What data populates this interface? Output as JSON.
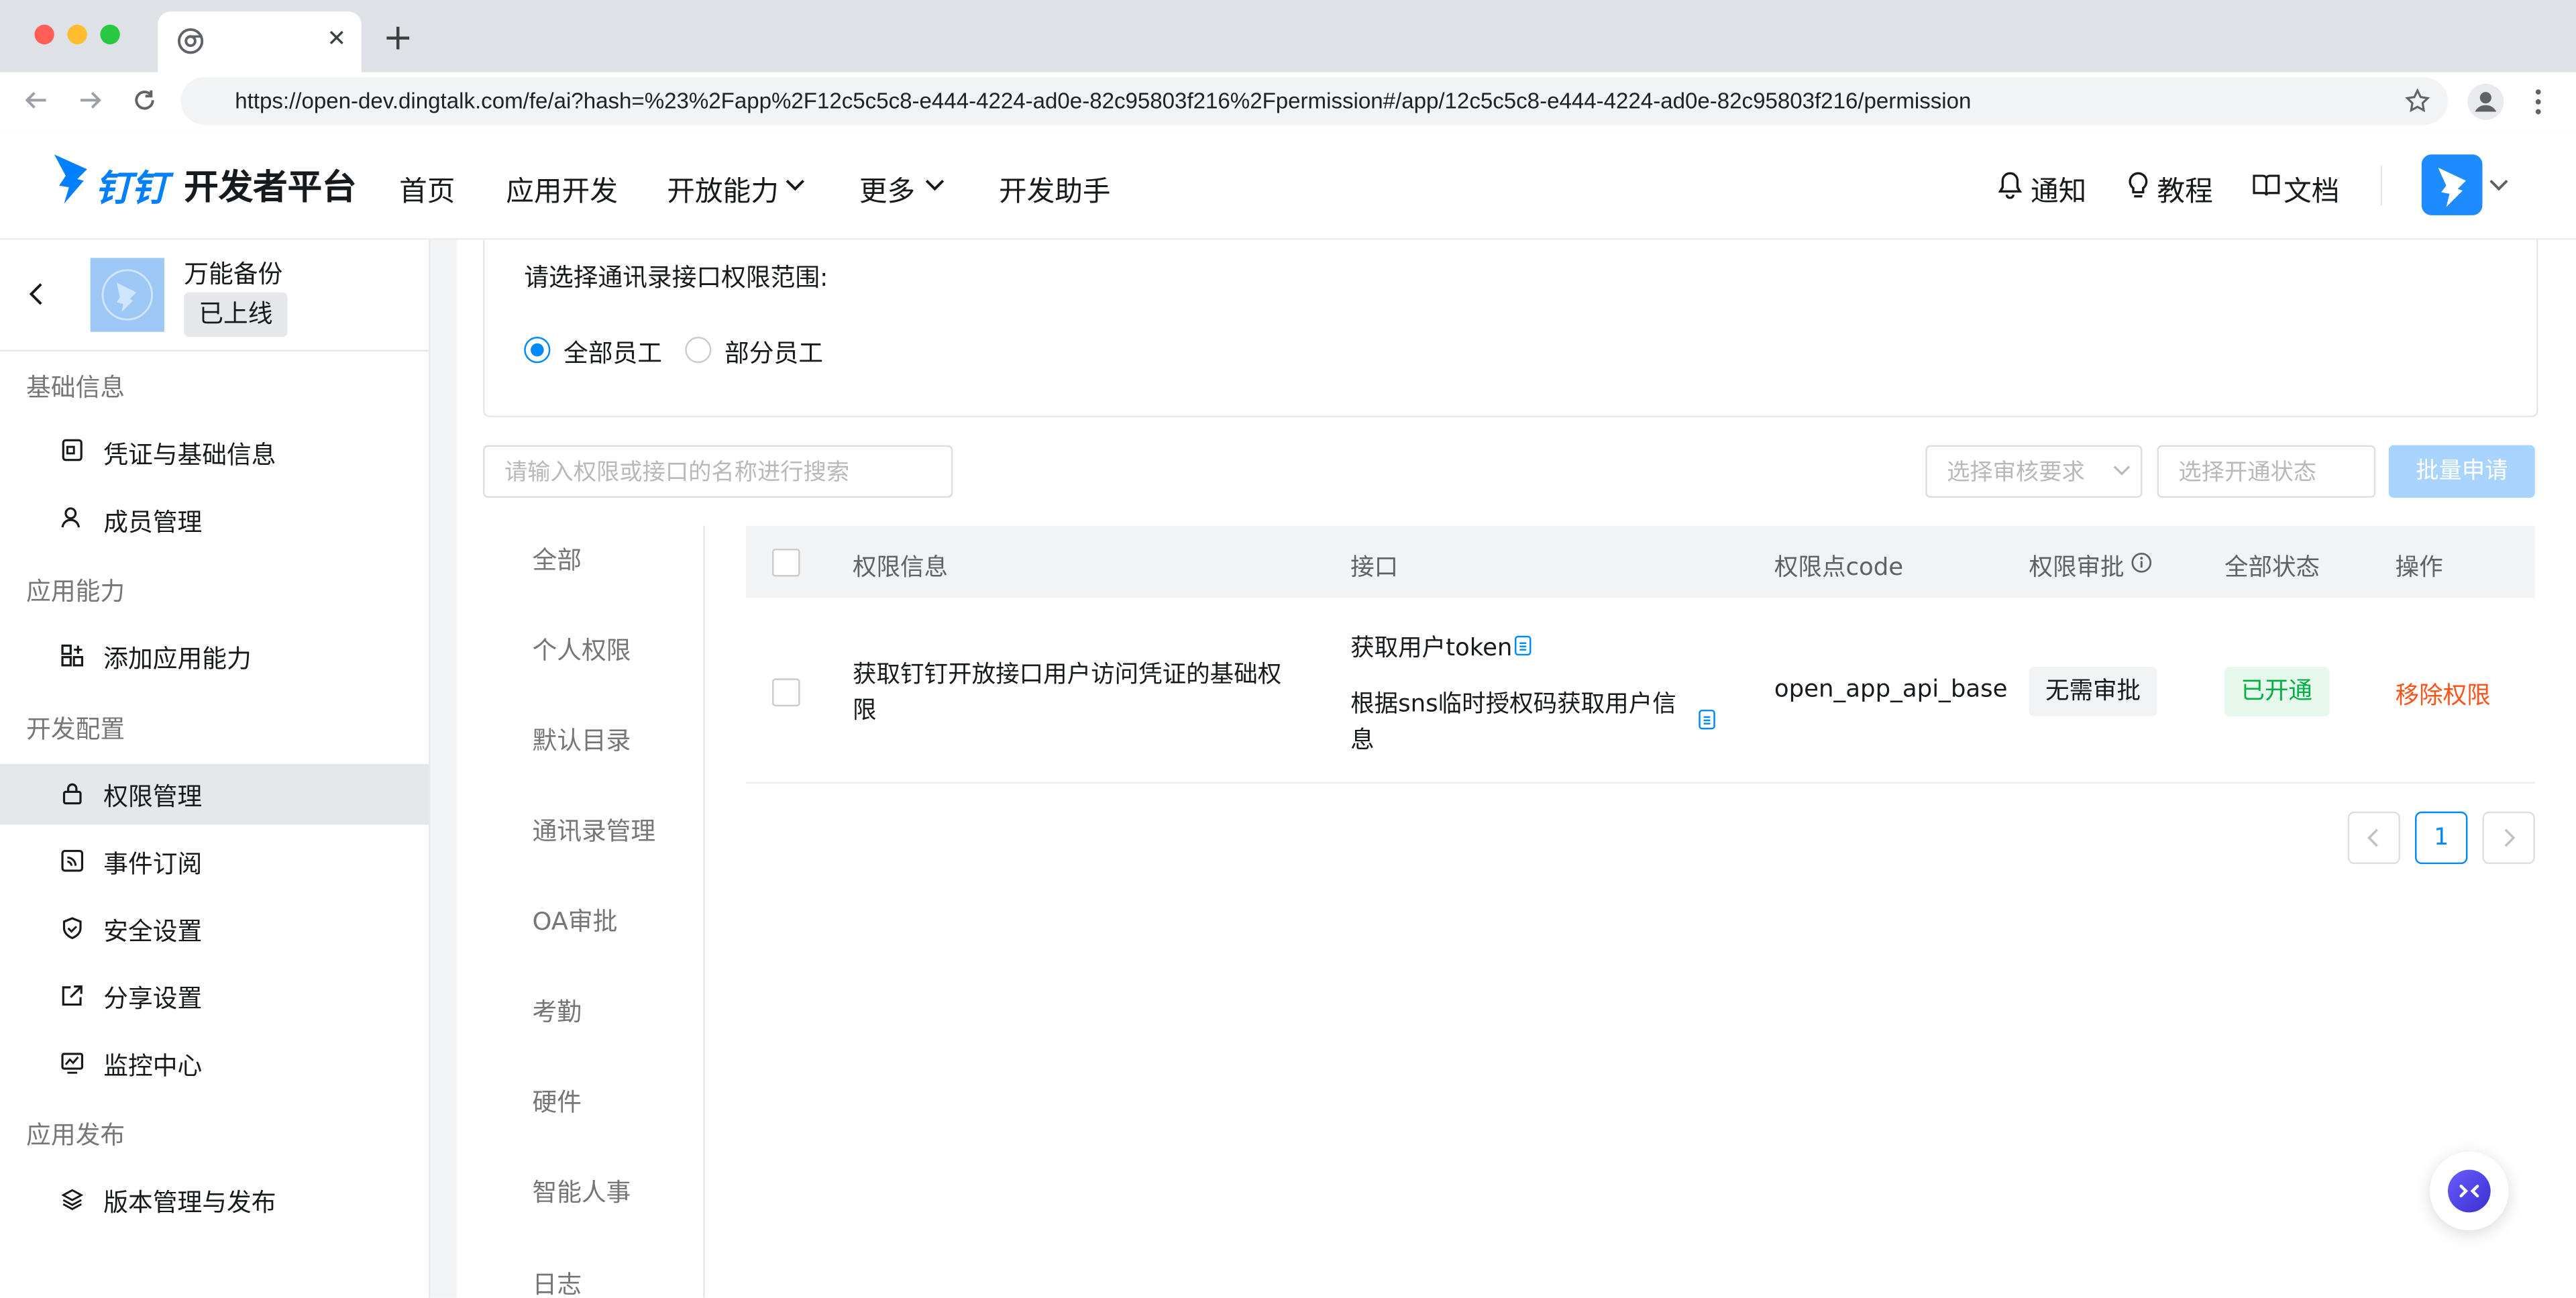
{
  "browser": {
    "url": "https://open-dev.dingtalk.com/fe/ai?hash=%23%2Fapp%2F12c5c5c8-e444-4224-ad0e-82c95803f216%2Fpermission#/app/12c5c5c8-e444-4224-ad0e-82c95803f216/permission",
    "new_tab": "+",
    "close_tab": "✕"
  },
  "header": {
    "logo_text": "钉钉",
    "platform_name": "开发者平台",
    "nav": [
      {
        "label": "首页"
      },
      {
        "label": "应用开发"
      },
      {
        "label": "开放能力"
      },
      {
        "label": "更多"
      },
      {
        "label": "开发助手"
      }
    ],
    "notify": "通知",
    "tutorial": "教程",
    "docs": "文档"
  },
  "app": {
    "name": "万能备份",
    "status": "已上线"
  },
  "sidebar": {
    "groups": [
      {
        "title": "基础信息",
        "items": [
          "凭证与基础信息",
          "成员管理"
        ]
      },
      {
        "title": "应用能力",
        "items": [
          "添加应用能力"
        ]
      },
      {
        "title": "开发配置",
        "items": [
          "权限管理",
          "事件订阅",
          "安全设置",
          "分享设置",
          "监控中心"
        ]
      },
      {
        "title": "应用发布",
        "items": [
          "版本管理与发布"
        ]
      }
    ],
    "active": "权限管理"
  },
  "scope": {
    "label": "请选择通讯录接口权限范围:",
    "options": [
      "全部员工",
      "部分员工"
    ],
    "selected": "全部员工"
  },
  "filters": {
    "search_placeholder": "请输入权限或接口的名称进行搜索",
    "audit_placeholder": "选择审核要求",
    "status_placeholder": "选择开通状态",
    "batch_button": "批量申请"
  },
  "categories": [
    "全部",
    "个人权限",
    "默认目录",
    "通讯录管理",
    "OA审批",
    "考勤",
    "硬件",
    "智能人事",
    "日志"
  ],
  "table": {
    "headers": [
      "权限信息",
      "接口",
      "权限点code",
      "权限审批",
      "全部状态",
      "操作"
    ],
    "rows": [
      {
        "info": "获取钉钉开放接口用户访问凭证的基础权限",
        "apis": [
          "获取用户token",
          "根据sns临时授权码获取用户信息"
        ],
        "code": "open_app_api_base",
        "approval": "无需审批",
        "status": "已开通",
        "action": "移除权限"
      }
    ]
  },
  "pagination": {
    "current": "1"
  },
  "colors": {
    "primary": "#0089ff",
    "success": "#00b042",
    "danger": "#ff5219"
  }
}
